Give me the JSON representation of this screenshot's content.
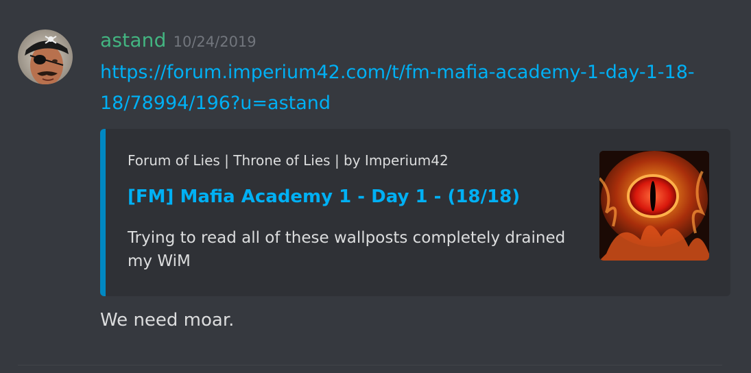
{
  "message": {
    "author": "astand",
    "timestamp": "10/24/2019",
    "link_text": "https://forum.imperium42.com/t/fm-mafia-academy-1-day-1-18-18/78994/196?u=astand",
    "body": "We need moar."
  },
  "embed": {
    "provider": "Forum of Lies | Throne of Lies | by Imperium42",
    "title": "[FM] Mafia Academy 1 - Day 1 - (18/18)",
    "description": "Trying to read all of these wallposts completely drained my WiM",
    "thumbnail_icon": "fiery-eye-image"
  },
  "colors": {
    "username": "#43b581",
    "link": "#00b0f4",
    "embed_accent": "#0088c2",
    "background": "#36393f",
    "embed_background": "#2f3136"
  },
  "avatar_icon": "pirate-avatar-image"
}
